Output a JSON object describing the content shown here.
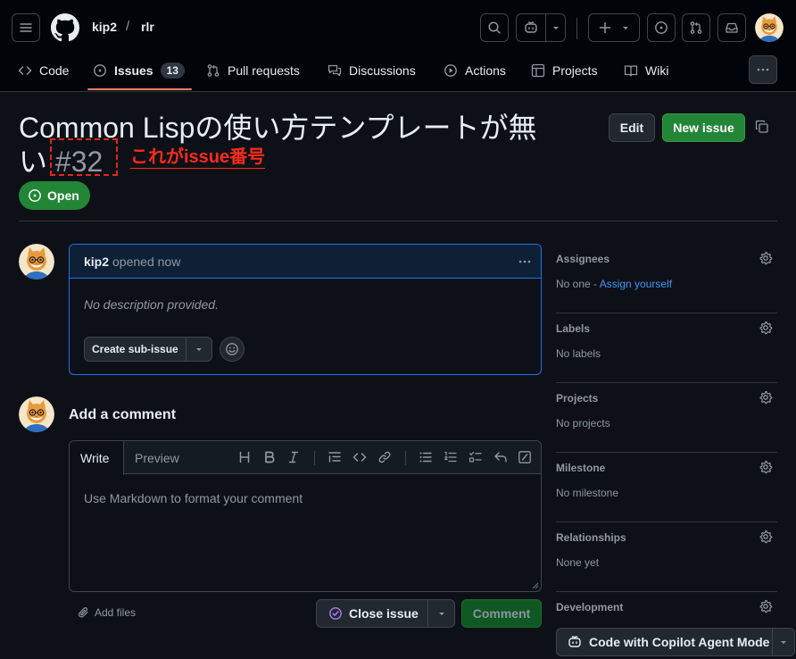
{
  "header": {
    "owner": "kip2",
    "separator": "/",
    "repo": "rlr"
  },
  "nav": {
    "tabs": [
      {
        "label": "Code",
        "icon": "code-icon"
      },
      {
        "label": "Issues",
        "icon": "issue-opened-icon",
        "count": "13",
        "active": true
      },
      {
        "label": "Pull requests",
        "icon": "git-pull-request-icon"
      },
      {
        "label": "Discussions",
        "icon": "comment-discussion-icon"
      },
      {
        "label": "Actions",
        "icon": "play-icon"
      },
      {
        "label": "Projects",
        "icon": "table-icon"
      },
      {
        "label": "Wiki",
        "icon": "book-icon"
      }
    ]
  },
  "issue": {
    "title": "Common Lispの使い方テンプレートが無い",
    "number": "#32",
    "annotation": "これがissue番号",
    "state": "Open",
    "edit_label": "Edit",
    "new_issue_label": "New issue"
  },
  "comment": {
    "author": "kip2",
    "meta": "opened now",
    "body": "No description provided.",
    "sub_issue_label": "Create sub-issue"
  },
  "composer": {
    "heading": "Add a comment",
    "tab_write": "Write",
    "tab_preview": "Preview",
    "placeholder": "Use Markdown to format your comment",
    "add_files": "Add files",
    "close_issue": "Close issue",
    "comment": "Comment"
  },
  "sidebar": {
    "assignees": {
      "title": "Assignees",
      "value": "No one - ",
      "link": "Assign yourself"
    },
    "labels": {
      "title": "Labels",
      "value": "No labels"
    },
    "projects": {
      "title": "Projects",
      "value": "No projects"
    },
    "milestone": {
      "title": "Milestone",
      "value": "No milestone"
    },
    "relationships": {
      "title": "Relationships",
      "value": "None yet"
    },
    "development": {
      "title": "Development",
      "button": "Code with Copilot Agent Mode"
    }
  },
  "colors": {
    "accent_green": "#238636",
    "link_blue": "#4493f8",
    "annotation_red": "#ff2a1a",
    "tab_underline": "#f78166"
  }
}
